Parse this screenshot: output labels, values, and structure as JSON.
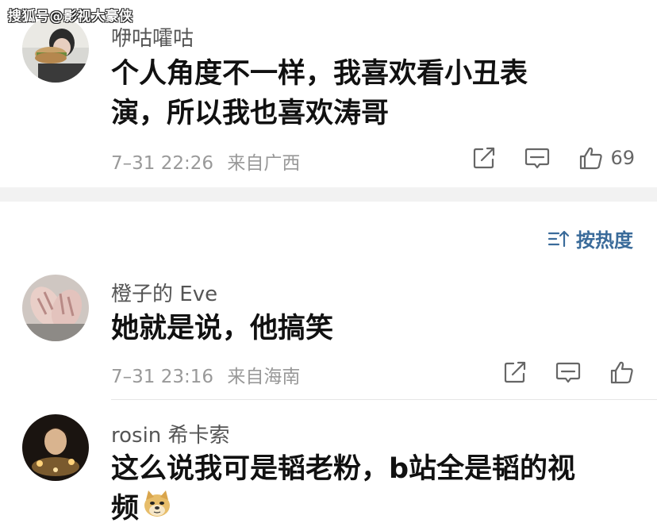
{
  "watermark": "搜狐号@影视大豪侠",
  "sort": {
    "label": "按热度"
  },
  "comments": [
    {
      "username": "咿咕嚯咕",
      "text_line1": "个人角度不一样，我喜欢看小丑表",
      "text_line2": "演，所以我也喜欢涛哥",
      "time": "7–31 22:26",
      "location": "来自广西",
      "likes": "69"
    },
    {
      "username": "橙子的 Eve",
      "text_line1": "她就是说，他搞笑",
      "time": "7–31 23:16",
      "location": "来自海南",
      "likes": ""
    },
    {
      "username": "rosin 希卡索",
      "text_line1": "这么说我可是韬老粉，b站全是韬的视",
      "text_line2": "频",
      "emoji": "doge-emoji"
    }
  ],
  "colors": {
    "link_blue": "#3a6b9a",
    "meta_gray": "#999999",
    "divider": "#f2f2f2"
  }
}
